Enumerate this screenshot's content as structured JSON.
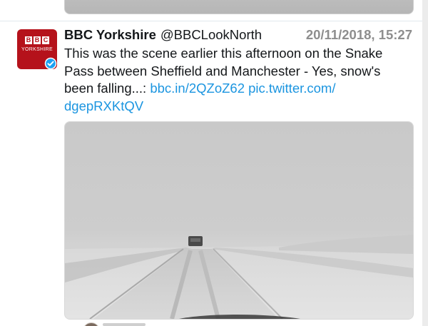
{
  "tweet": {
    "display_name": "BBC Yorkshire",
    "handle": "@BBCLookNorth",
    "timestamp": "20/11/2018, 15:27",
    "text_plain": "This was the scene earlier this afternoon on the Snake Pass between Sheffield and Manchester - Yes, snow's been falling...: ",
    "link_short": "bbc.in/2QZoZ62",
    "link_pic_part1": "pic.twitter.com/",
    "link_pic_part2": "dgepRXKtQV",
    "avatar": {
      "logo_letters": [
        "B",
        "B",
        "C"
      ],
      "logo_subtitle": "YORKSHIRE",
      "verified_icon": "verified-badge-icon",
      "color": "#b5121b"
    },
    "media": {
      "kind": "photo",
      "scene": "snow-covered road with car"
    }
  },
  "colors": {
    "link": "#1b95e0",
    "text": "#14171a",
    "timestamp": "#8e8e8e"
  }
}
